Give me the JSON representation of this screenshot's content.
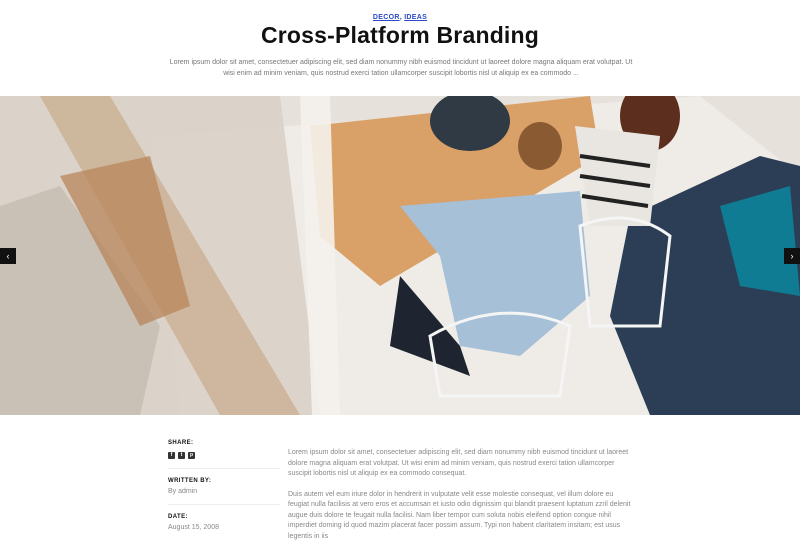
{
  "post": {
    "categories": [
      "DECOR",
      "IDEAS"
    ],
    "separator": ", ",
    "title": "Cross-Platform Branding",
    "lead": "Lorem ipsum dolor sit amet, consectetuer adipiscing elit, sed diam nonummy nibh euismod tincidunt ut laoreet dolore magna aliquam erat volutpat. Ut wisi enim ad minim veniam, quis nostrud exerci tation ullamcorper suscipit lobortis nisl ut aliquip ex ea commodo ..."
  },
  "slider": {
    "prev_icon": "chevron-left-icon",
    "next_icon": "chevron-right-icon",
    "prev_glyph": "‹",
    "next_glyph": "›"
  },
  "meta": {
    "share_label": "SHARE:",
    "share_icons": [
      {
        "name": "facebook-icon",
        "glyph": "f"
      },
      {
        "name": "twitter-icon",
        "glyph": "t"
      },
      {
        "name": "pinterest-icon",
        "glyph": "p"
      }
    ],
    "written_by_label": "WRITTEN BY:",
    "author": "By admin",
    "date_label": "DATE:",
    "date": "August 15, 2008"
  },
  "content": {
    "paragraphs": [
      "Lorem ipsum dolor sit amet, consectetuer adipiscing elit, sed diam nonummy nibh euismod tincidunt ut laoreet dolore magna aliquam erat volutpat. Ut wisi enim ad minim veniam, quis nostrud exerci tation ullamcorper suscipit lobortis nisl ut aliquip ex ea commodo consequat.",
      "Duis autem vel eum iriure dolor in hendrerit in vulputate velit esse molestie consequat, vel illum dolore eu feugiat nulla facilisis at vero eros et accumsan et iusto odio dignissim qui blandit praesent luptatum zzril delenit augue duis dolore te feugait nulla facilisi. Nam liber tempor cum soluta nobis eleifend option congue nihil imperdiet doming id quod mazim placerat facer possim assum. Typi non habent claritatem insitam; est usus legentis in iis"
    ]
  }
}
